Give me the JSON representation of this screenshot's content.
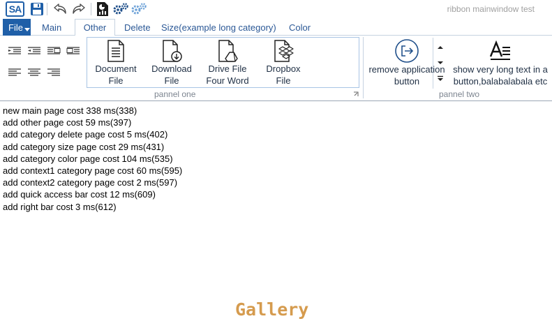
{
  "quick_access": {
    "logo_text": "SA",
    "items": [
      "save-icon",
      "undo-icon",
      "redo-icon",
      "document-chart-icon",
      "gears-icon",
      "settings-icon"
    ]
  },
  "window_title": "ribbon mainwindow test",
  "file_button": {
    "label": "File"
  },
  "tabs": [
    "Main",
    "Other",
    "Delete",
    "Size(example long category)",
    "Color"
  ],
  "active_tab": "Other",
  "ribbon": {
    "panels": [
      {
        "name": "pannel one",
        "large_buttons": [
          {
            "label_line1": "Document",
            "label_line2": "File",
            "icon": "document-icon"
          },
          {
            "label_line1": "Download",
            "label_line2": "File",
            "icon": "download-file-icon"
          },
          {
            "label_line1": "Drive File",
            "label_line2": "Four Word",
            "icon": "drive-file-icon"
          },
          {
            "label_line1": "Dropbox",
            "label_line2": "File",
            "icon": "dropbox-icon"
          }
        ]
      },
      {
        "name": "pannel two",
        "large_buttons": [
          {
            "label_line1": "remove application",
            "label_line2": "button",
            "icon": "exit-icon"
          },
          {
            "label_line1": "show very long text in a",
            "label_line2": "button,balabalabala etc",
            "icon": "text-format-icon"
          }
        ]
      }
    ]
  },
  "log_lines": [
    "new main page cost 338 ms(338)",
    "add other page cost 59 ms(397)",
    "add category delete page cost 5 ms(402)",
    "add category size page cost 29 ms(431)",
    "add category color page cost 104 ms(535)",
    "add context1 category page cost 60 ms(595)",
    "add context2 category page cost 2 ms(597)",
    "add quick access bar cost 12 ms(609)",
    "add right bar cost 3 ms(612)"
  ],
  "gallery_label": "Gallery",
  "colors": {
    "accent": "#1f5fa8",
    "gallery": "#d59b4e",
    "tab_text": "#2b5896"
  }
}
